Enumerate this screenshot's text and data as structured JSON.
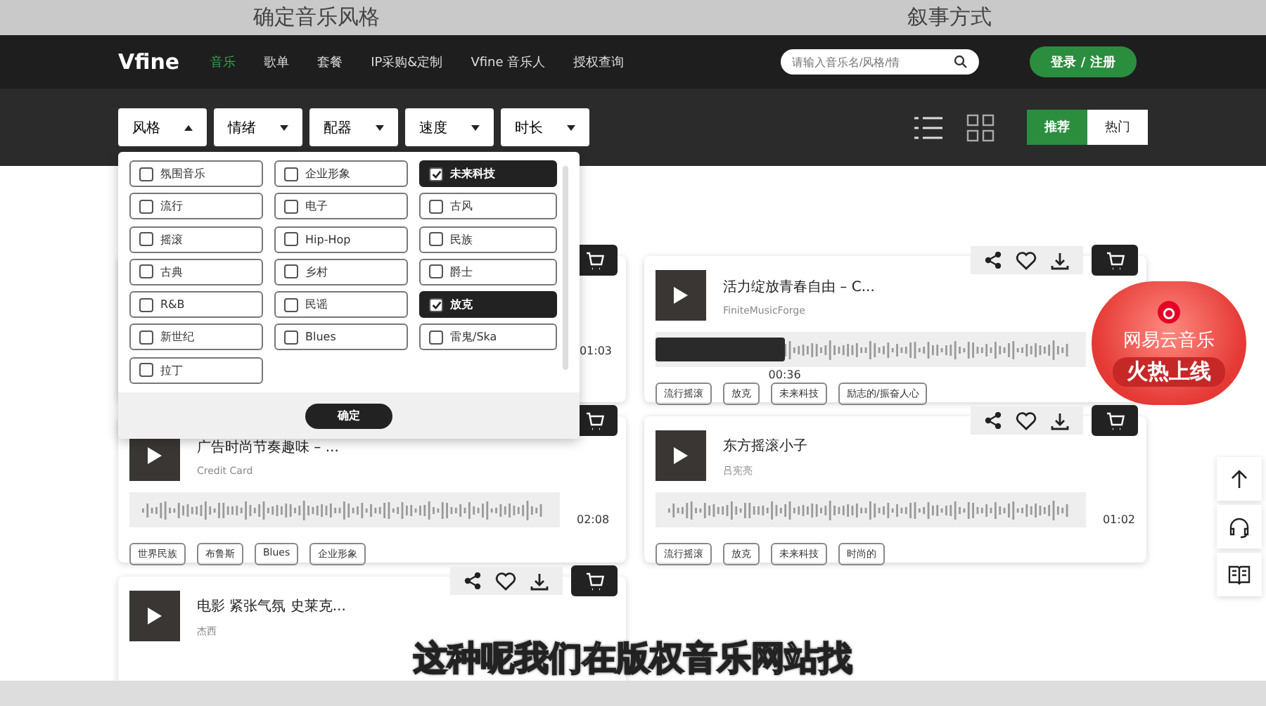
{
  "video_header": [
    "确定音乐风格",
    "叙事方式"
  ],
  "nav": {
    "logo": "Vfine",
    "items": [
      {
        "label": "音乐",
        "selected": true
      },
      {
        "label": "歌单",
        "selected": false
      },
      {
        "label": "套餐",
        "selected": false
      },
      {
        "label": "IP采购&定制",
        "selected": false
      },
      {
        "label": "Vfine 音乐人",
        "selected": false
      },
      {
        "label": "授权查询",
        "selected": false
      }
    ],
    "search": {
      "placeholder": "请输入音乐名/风格/情"
    },
    "login": "登录 / 注册"
  },
  "filters": [
    {
      "label": "风格",
      "open": true
    },
    {
      "label": "情绪",
      "open": false
    },
    {
      "label": "配器",
      "open": false
    },
    {
      "label": "速度",
      "open": false
    },
    {
      "label": "时长",
      "open": false
    }
  ],
  "sort": [
    {
      "label": "推荐",
      "selected": true
    },
    {
      "label": "热门",
      "selected": false
    }
  ],
  "style_dropdown": {
    "options": [
      {
        "label": "氛围音乐",
        "checked": false
      },
      {
        "label": "企业形象",
        "checked": false
      },
      {
        "label": "未来科技",
        "checked": true
      },
      {
        "label": "流行",
        "checked": false
      },
      {
        "label": "电子",
        "checked": false
      },
      {
        "label": "古风",
        "checked": false
      },
      {
        "label": "摇滚",
        "checked": false
      },
      {
        "label": "Hip-Hop",
        "checked": false
      },
      {
        "label": "民族",
        "checked": false
      },
      {
        "label": "古典",
        "checked": false
      },
      {
        "label": "乡村",
        "checked": false
      },
      {
        "label": "爵士",
        "checked": false
      },
      {
        "label": "R&B",
        "checked": false
      },
      {
        "label": "民谣",
        "checked": false
      },
      {
        "label": "放克",
        "checked": true
      },
      {
        "label": "新世纪",
        "checked": false
      },
      {
        "label": "Blues",
        "checked": false
      },
      {
        "label": "雷鬼/Ska",
        "checked": false
      },
      {
        "label": "拉丁",
        "checked": false
      }
    ],
    "confirm": "确定"
  },
  "tracks": [
    {
      "duration": "01:03"
    },
    {
      "title": "活力绽放青春自由 – C...",
      "artist": "FiniteMusicForge",
      "level": 0.3,
      "position": "00:36",
      "tags": [
        "流行摇滚",
        "放克",
        "未来科技",
        "励志的/振奋人心"
      ]
    },
    {
      "title": "广告时尚节奏趣味 – ...",
      "artist": "Credit Card",
      "duration": "02:08",
      "tags": [
        "世界民族",
        "布鲁斯",
        "Blues",
        "企业形象"
      ]
    },
    {
      "title": "东方摇滚小子",
      "artist": "吕宪亮",
      "duration": "01:02",
      "tags": [
        "流行摇滚",
        "放克",
        "未来科技",
        "时尚的"
      ]
    },
    {
      "title": "电影 紧张气氛 史莱克...",
      "artist": "杰西"
    }
  ],
  "promo_badge": {
    "brand": "网易云音乐",
    "slogan": "火热上线"
  },
  "subtitle": "这种呢我们在版权音乐网站找"
}
